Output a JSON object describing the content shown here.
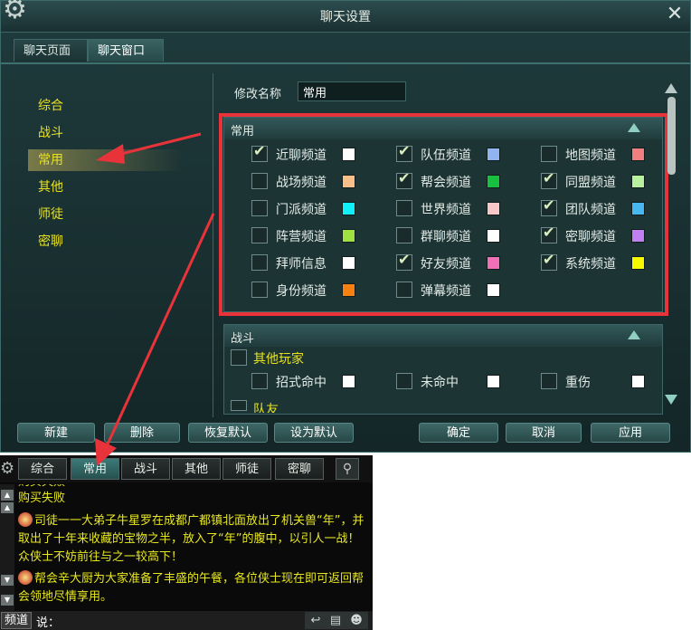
{
  "dialog": {
    "title": "聊天设置",
    "tabs": [
      "聊天页面",
      "聊天窗口"
    ],
    "active_tab": "聊天窗口",
    "nav": [
      "综合",
      "战斗",
      "常用",
      "其他",
      "师徒",
      "密聊"
    ],
    "selected_nav": "常用",
    "rename_label": "修改名称",
    "rename_value": "常用",
    "section_common": {
      "title": "常用",
      "rows": [
        [
          {
            "label": "近聊频道",
            "checked": true,
            "color": "#ffffff"
          },
          {
            "label": "队伍频道",
            "checked": true,
            "color": "#8fb4f0"
          },
          {
            "label": "地图频道",
            "checked": false,
            "color": "#f08080"
          }
        ],
        [
          {
            "label": "战场频道",
            "checked": false,
            "color": "#f8c088"
          },
          {
            "label": "帮会频道",
            "checked": true,
            "color": "#18c040"
          },
          {
            "label": "同盟频道",
            "checked": true,
            "color": "#b8f0a0"
          }
        ],
        [
          {
            "label": "门派频道",
            "checked": false,
            "color": "#10f0f8"
          },
          {
            "label": "世界频道",
            "checked": false,
            "color": "#f8c8c8"
          },
          {
            "label": "团队频道",
            "checked": true,
            "color": "#48b8f0"
          }
        ],
        [
          {
            "label": "阵营频道",
            "checked": false,
            "color": "#a0e040"
          },
          {
            "label": "群聊频道",
            "checked": false,
            "color": "#ffffff"
          },
          {
            "label": "密聊频道",
            "checked": true,
            "color": "#c080f0"
          }
        ],
        [
          {
            "label": "拜师信息",
            "checked": false,
            "color": "#ffffff"
          },
          {
            "label": "好友频道",
            "checked": true,
            "color": "#f070b8"
          },
          {
            "label": "系统频道",
            "checked": true,
            "color": "#f8f800"
          }
        ],
        [
          {
            "label": "身份频道",
            "checked": false,
            "color": "#f88010"
          },
          {
            "label": "弹幕频道",
            "checked": false,
            "color": "#ffffff"
          }
        ]
      ]
    },
    "section_battle": {
      "title": "战斗",
      "group1": "其他玩家",
      "items": [
        {
          "label": "招式命中",
          "checked": false,
          "color": "#ffffff"
        },
        {
          "label": "未命中",
          "checked": false,
          "color": "#ffffff"
        },
        {
          "label": "重伤",
          "checked": false,
          "color": "#ffffff"
        }
      ],
      "group2": "队友"
    },
    "buttons": {
      "new": "新建",
      "delete": "删除",
      "restore": "恢复默认",
      "set_default": "设为默认",
      "ok": "确定",
      "cancel": "取消",
      "apply": "应用"
    }
  },
  "chat": {
    "tabs": [
      "综合",
      "常用",
      "战斗",
      "其他",
      "师徒",
      "密聊"
    ],
    "active_tab": "常用",
    "messages": [
      "购买失败",
      "购买失败",
      "司徒一一大弟子牛星罗在成都广都镇北面放出了机关兽“年”，并取出了十年来收藏的宝物之半，放入了“年”的腹中，以引人一战！众侠士不妨前往与之一较高下！",
      "帮会辛大厨为大家准备了丰盛的午餐，各位侠士现在即可返回帮会领地尽情享用。"
    ],
    "channel_label": "频道",
    "say_label": "说："
  },
  "colors": {
    "highlight_red": "#e8333a",
    "text_yellow": "#e8e220",
    "accent_teal": "#3c7a78"
  }
}
